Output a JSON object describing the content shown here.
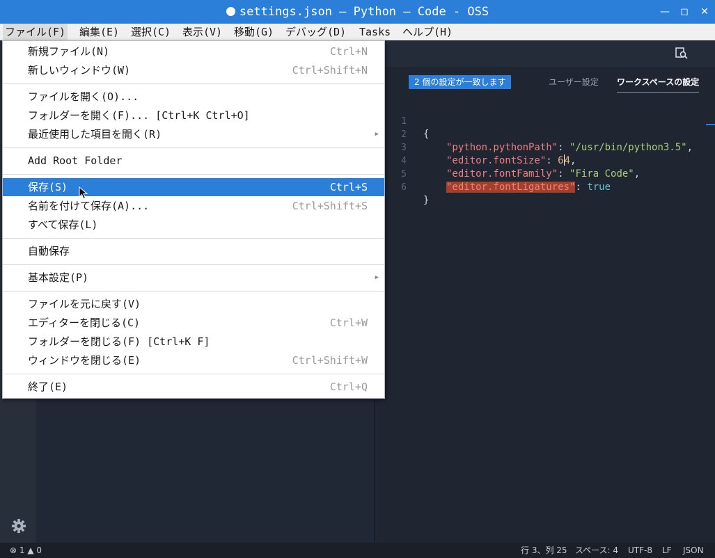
{
  "window": {
    "title": "settings.json — Python — Code - OSS",
    "controls": [
      "minimize-icon",
      "maximize-icon",
      "close-icon"
    ]
  },
  "menubar": {
    "items": [
      "ファイル(F)",
      "編集(E)",
      "選択(C)",
      "表示(V)",
      "移動(G)",
      "デバッグ(D)",
      "Tasks",
      "ヘルプ(H)"
    ]
  },
  "file_menu": {
    "items": [
      {
        "label": "新規ファイル(N)",
        "shortcut": "Ctrl+N"
      },
      {
        "label": "新しいウィンドウ(W)",
        "shortcut": "Ctrl+Shift+N"
      },
      {
        "label": "ファイルを開く(O)...",
        "shortcut": ""
      },
      {
        "label": "フォルダーを開く(F)... [Ctrl+K Ctrl+O]",
        "shortcut": ""
      },
      {
        "label": "最近使用した項目を開く(R)",
        "shortcut": ""
      },
      {
        "label": "Add Root Folder",
        "shortcut": ""
      },
      {
        "label": "保存(S)",
        "shortcut": "Ctrl+S"
      },
      {
        "label": "名前を付けて保存(A)...",
        "shortcut": "Ctrl+Shift+S"
      },
      {
        "label": "すべて保存(L)",
        "shortcut": ""
      },
      {
        "label": "自動保存",
        "shortcut": ""
      },
      {
        "label": "基本設定(P)",
        "shortcut": ""
      },
      {
        "label": "ファイルを元に戻す(V)",
        "shortcut": ""
      },
      {
        "label": "エディターを閉じる(C)",
        "shortcut": "Ctrl+W"
      },
      {
        "label": "フォルダーを閉じる(F) [Ctrl+K F]",
        "shortcut": ""
      },
      {
        "label": "ウィンドウを閉じる(E)",
        "shortcut": "Ctrl+Shift+W"
      },
      {
        "label": "終了(E)",
        "shortcut": "Ctrl+Q"
      }
    ]
  },
  "settings": {
    "match_badge": "2 個の設定が一致します",
    "user_tab": "ユーザー設定",
    "workspace_tab": "ワークスペースの設定"
  },
  "code": {
    "line_numbers": [
      "1",
      "2",
      "3",
      "4",
      "5",
      "6"
    ],
    "open_brace": "{",
    "close_brace": "}",
    "k1": "\"python.pythonPath\"",
    "v1": "\"/usr/bin/python3.5\"",
    "k2": "\"editor.fontSize\"",
    "v2a": "6",
    "v2b": "4",
    "k3": "\"editor.fontFamily\"",
    "v3": "\"Fira Code\"",
    "k4": "\"editor.fontLigatures\"",
    "v4": "true",
    "colon": ": ",
    "comma": ","
  },
  "statusbar": {
    "errors": "1",
    "warnings": "0",
    "position": "行 3、列 25",
    "spaces": "スペース: 4",
    "encoding": "UTF-8",
    "eol": "LF",
    "language": "JSON"
  },
  "colors": {
    "accent": "#2b7fd8",
    "editor_bg": "#1f2531",
    "menu_highlight": "#2b7fd8",
    "search_highlight": "#a4402a"
  }
}
